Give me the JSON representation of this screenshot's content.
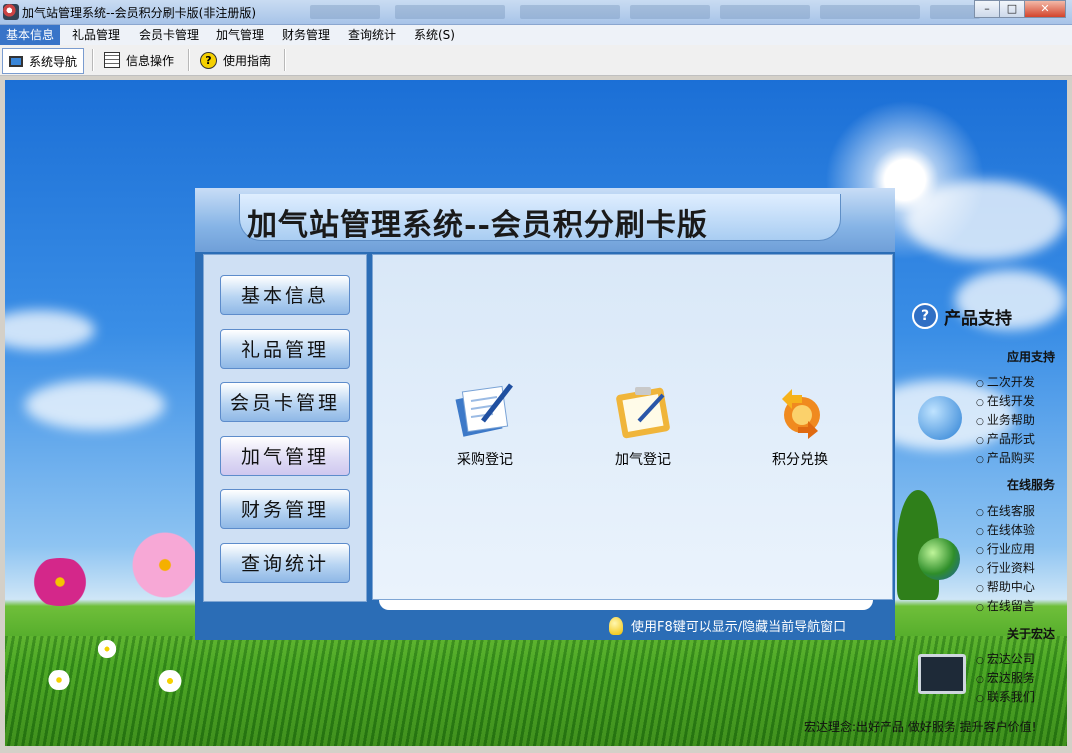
{
  "window": {
    "title": "加气站管理系统--会员积分刷卡版(非注册版)",
    "controls": [
      "minimize",
      "maximize",
      "close"
    ]
  },
  "menu": {
    "items": [
      "基本信息",
      "礼品管理",
      "会员卡管理",
      "加气管理",
      "财务管理",
      "查询统计",
      "系统(S)"
    ],
    "active": "基本信息"
  },
  "toolbar": {
    "buttons": [
      {
        "label": "系统导航",
        "icon": "monitor-icon"
      },
      {
        "label": "信息操作",
        "icon": "grid-icon"
      },
      {
        "label": "使用指南",
        "icon": "help-icon"
      }
    ]
  },
  "nav": {
    "title": "加气站管理系统--会员积分刷卡版",
    "side": [
      "基本信息",
      "礼品管理",
      "会员卡管理",
      "加气管理",
      "财务管理",
      "查询统计"
    ],
    "selected_side": "加气管理",
    "functions": [
      "采购登记",
      "加气登记",
      "积分兑换"
    ],
    "footer_hint": "使用F8键可以显示/隐藏当前导航窗口"
  },
  "support": {
    "title": "产品支持",
    "sections": [
      {
        "heading": "应用支持",
        "links": [
          "二次开发",
          "在线开发",
          "业务帮助",
          "产品形式",
          "产品购买"
        ]
      },
      {
        "heading": "在线服务",
        "links": [
          "在线客服",
          "在线体验",
          "行业应用",
          "行业资料",
          "帮助中心",
          "在线留言"
        ]
      },
      {
        "heading": "关于宏达",
        "links": [
          "宏达公司",
          "宏达服务",
          "联系我们"
        ]
      }
    ],
    "slogan": "宏达理念:出好产品 做好服务 提升客户价值!"
  }
}
